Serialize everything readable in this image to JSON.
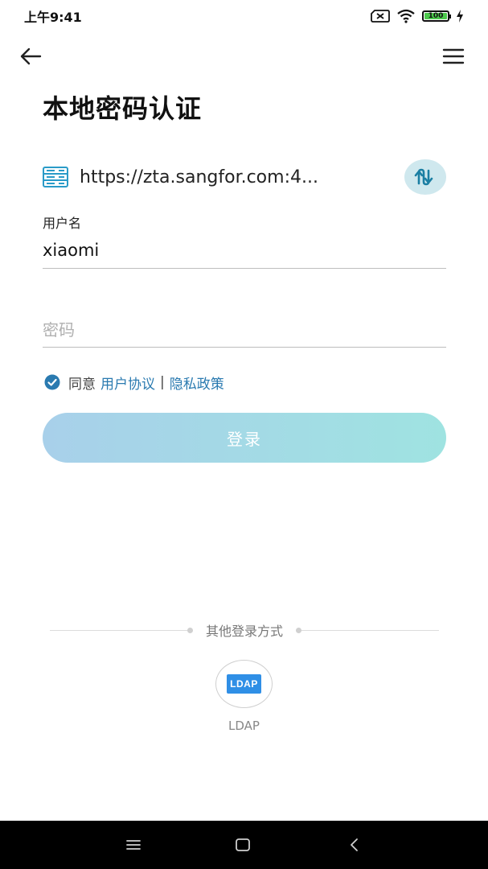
{
  "status_bar": {
    "time": "上午9:41",
    "battery_level": "100",
    "icons": [
      "sim-none-icon",
      "wifi-icon",
      "battery-icon",
      "charging-icon"
    ]
  },
  "header": {
    "icons": [
      "back-arrow-icon",
      "menu-icon"
    ]
  },
  "page_title": "本地密码认证",
  "server": {
    "url": "https://zta.sangfor.com:4...",
    "icons": [
      "server-icon",
      "switch-server-icon"
    ]
  },
  "username": {
    "label": "用户名",
    "value": "xiaomi"
  },
  "password": {
    "placeholder": "密码",
    "value": ""
  },
  "agreement": {
    "checked": true,
    "prefix": "同意",
    "user_agreement": "用户协议",
    "separator": "|",
    "privacy_policy": "隐私政策"
  },
  "login_button": {
    "label": "登录"
  },
  "other_methods": {
    "title": "其他登录方式",
    "ldap_badge": "LDAP",
    "ldap_label": "LDAP"
  },
  "colors": {
    "link": "#2a7ab0",
    "button_gradient_start": "#a8d0ea",
    "button_gradient_end": "#9fe3e1",
    "server_icon": "#2a9bc8",
    "ldap_badge": "#2f8fe6"
  },
  "nav_bar": {
    "icons": [
      "recent-apps-icon",
      "home-icon",
      "back-icon"
    ]
  }
}
